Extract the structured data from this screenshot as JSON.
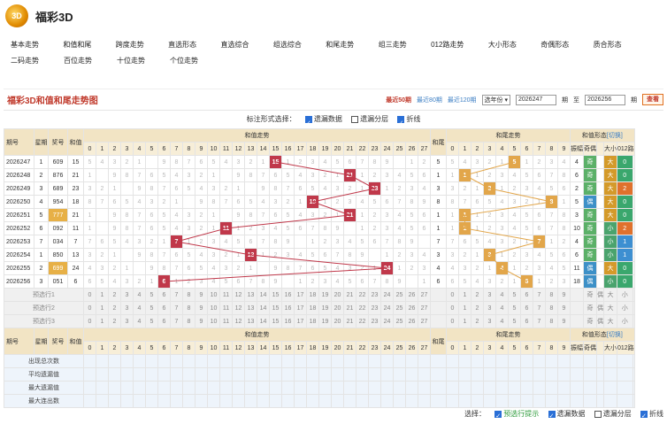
{
  "app": {
    "logo": "3D",
    "title": "福彩3D"
  },
  "nav": {
    "row1": [
      "基本走势",
      "和值和尾",
      "跨度走势",
      "直选形态",
      "直选综合",
      "组选综合",
      "和尾走势",
      "组三走势",
      "012路走势",
      "大小形态",
      "奇偶形态",
      "质合形态"
    ],
    "row2": [
      "二码走势",
      "百位走势",
      "十位走势",
      "个位走势"
    ]
  },
  "panel": {
    "title": "福彩3D和值和尾走势图",
    "recent": [
      "最近50期",
      "最近80期",
      "最近120期"
    ],
    "select": "选年份",
    "from": "2026247",
    "from_label": "期",
    "to_label": "至",
    "to": "2026256",
    "to_unit": "期",
    "query": "查看"
  },
  "options": {
    "label": "标注形式选择：",
    "items": [
      "遗漏数据",
      "遗漏分层",
      "折线"
    ]
  },
  "headers": {
    "issue": "期号",
    "week": "星期",
    "prize": "奖号",
    "sum": "和值",
    "sum_trend": "和值走势",
    "tail": "和尾",
    "tail_trend": "和尾走势",
    "form": "和值形态",
    "switch": "[切换]",
    "odd_even": "奇偶",
    "big_small": "大小",
    "route": "012路",
    "form_cols": [
      "振幅",
      "奇偶",
      "大小",
      "012路"
    ]
  },
  "rows": [
    {
      "issue": "2026247",
      "week": "1",
      "prize": "609",
      "sum": "15",
      "tail": "5",
      "amp": "4",
      "oe": "奇",
      "bs": "大",
      "r": "0"
    },
    {
      "issue": "2026248",
      "week": "2",
      "prize": "876",
      "sum": "21",
      "tail": "1",
      "amp": "6",
      "oe": "奇",
      "bs": "大",
      "r": "0"
    },
    {
      "issue": "2026249",
      "week": "3",
      "prize": "689",
      "sum": "23",
      "tail": "3",
      "amp": "2",
      "oe": "奇",
      "bs": "大",
      "r": "2"
    },
    {
      "issue": "2026250",
      "week": "4",
      "prize": "954",
      "sum": "18",
      "tail": "8",
      "amp": "5",
      "oe": "偶",
      "bs": "大",
      "r": "0"
    },
    {
      "issue": "2026251",
      "week": "5",
      "prize": "777",
      "sum": "21",
      "tail": "1",
      "amp": "3",
      "oe": "奇",
      "bs": "大",
      "r": "0"
    },
    {
      "issue": "2026252",
      "week": "6",
      "prize": "092",
      "sum": "11",
      "tail": "1",
      "amp": "10",
      "oe": "奇",
      "bs": "小",
      "r": "2"
    },
    {
      "issue": "2026253",
      "week": "7",
      "prize": "034",
      "sum": "7",
      "tail": "7",
      "amp": "4",
      "oe": "奇",
      "bs": "小",
      "r": "1"
    },
    {
      "issue": "2026254",
      "week": "1",
      "prize": "850",
      "sum": "13",
      "tail": "3",
      "amp": "6",
      "oe": "奇",
      "bs": "小",
      "r": "1"
    },
    {
      "issue": "2026255",
      "week": "2",
      "prize": "699",
      "sum": "24",
      "tail": "4",
      "amp": "11",
      "oe": "偶",
      "bs": "大",
      "r": "0"
    },
    {
      "issue": "2026256",
      "week": "3",
      "prize": "051",
      "sum": "6",
      "tail": "6",
      "amp": "18",
      "oe": "偶",
      "bs": "小",
      "r": "0"
    }
  ],
  "predict": [
    "预选行1",
    "预选行2",
    "预选行3"
  ],
  "stats": [
    "出现总次数",
    "平均遗漏值",
    "最大遗漏值",
    "最大连出数"
  ],
  "footer": {
    "label": "选择：",
    "items": [
      "预选行提示",
      "遗漏数据",
      "遗漏分层",
      "折线"
    ]
  }
}
